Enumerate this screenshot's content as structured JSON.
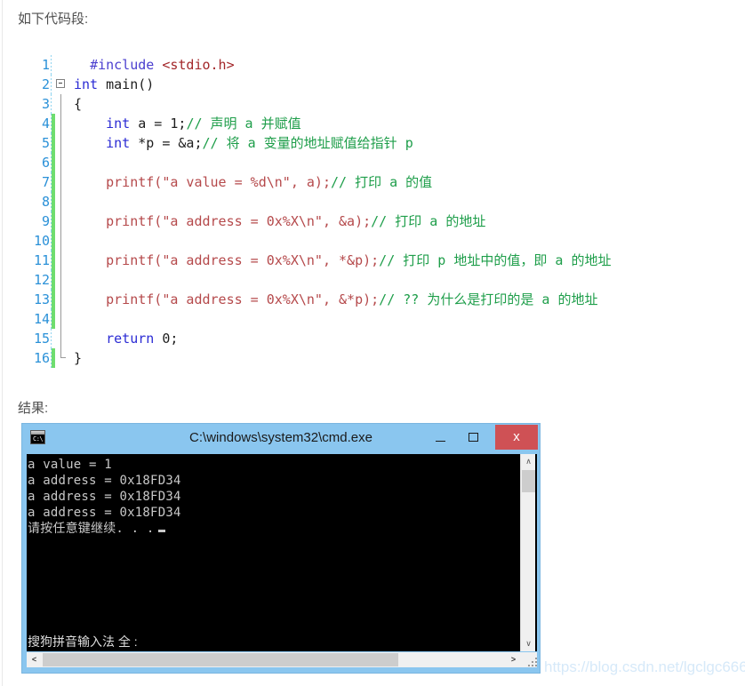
{
  "page": {
    "intro_label": "如下代码段:",
    "result_label": "结果:",
    "watermark": "https://blog.csdn.net/lgclgc666"
  },
  "code": {
    "language": "c",
    "lines": [
      {
        "num": "1",
        "fold": "none",
        "changed": false,
        "tokens": [
          {
            "t": "  ",
            "c": "plain"
          },
          {
            "t": "#include",
            "c": "pre"
          },
          {
            "t": " ",
            "c": "plain"
          },
          {
            "t": "<stdio.h>",
            "c": "hdr"
          }
        ]
      },
      {
        "num": "2",
        "fold": "open",
        "changed": false,
        "tokens": [
          {
            "t": "int",
            "c": "kw"
          },
          {
            "t": " main()",
            "c": "plain"
          }
        ]
      },
      {
        "num": "3",
        "fold": "line",
        "changed": false,
        "tokens": [
          {
            "t": "{",
            "c": "plain"
          }
        ]
      },
      {
        "num": "4",
        "fold": "line",
        "changed": true,
        "tokens": [
          {
            "t": "    ",
            "c": "plain"
          },
          {
            "t": "int",
            "c": "kw"
          },
          {
            "t": " a = 1;",
            "c": "plain"
          },
          {
            "t": "// 声明 a 并赋值",
            "c": "cmt"
          }
        ]
      },
      {
        "num": "5",
        "fold": "line",
        "changed": true,
        "tokens": [
          {
            "t": "    ",
            "c": "plain"
          },
          {
            "t": "int",
            "c": "kw"
          },
          {
            "t": " *p = &a;",
            "c": "plain"
          },
          {
            "t": "// 将 a 变量的地址赋值给指针 p",
            "c": "cmt"
          }
        ]
      },
      {
        "num": "6",
        "fold": "line",
        "changed": true,
        "tokens": [
          {
            "t": "",
            "c": "plain"
          }
        ]
      },
      {
        "num": "7",
        "fold": "line",
        "changed": true,
        "tokens": [
          {
            "t": "    ",
            "c": "plain"
          },
          {
            "t": "printf(\"a value = %d\\n\", a);",
            "c": "str"
          },
          {
            "t": "// 打印 a 的值",
            "c": "cmt"
          }
        ]
      },
      {
        "num": "8",
        "fold": "line",
        "changed": true,
        "tokens": [
          {
            "t": "",
            "c": "plain"
          }
        ]
      },
      {
        "num": "9",
        "fold": "line",
        "changed": true,
        "tokens": [
          {
            "t": "    ",
            "c": "plain"
          },
          {
            "t": "printf(\"a address = 0x%X\\n\", &a);",
            "c": "str"
          },
          {
            "t": "// 打印 a 的地址",
            "c": "cmt"
          }
        ]
      },
      {
        "num": "10",
        "fold": "line",
        "changed": true,
        "tokens": [
          {
            "t": "",
            "c": "plain"
          }
        ]
      },
      {
        "num": "11",
        "fold": "line",
        "changed": true,
        "tokens": [
          {
            "t": "    ",
            "c": "plain"
          },
          {
            "t": "printf(\"a address = 0x%X\\n\", *&p);",
            "c": "str"
          },
          {
            "t": "// 打印 p 地址中的值，即 a 的地址",
            "c": "cmt"
          }
        ]
      },
      {
        "num": "12",
        "fold": "line",
        "changed": true,
        "tokens": [
          {
            "t": "",
            "c": "plain"
          }
        ]
      },
      {
        "num": "13",
        "fold": "line",
        "changed": true,
        "tokens": [
          {
            "t": "    ",
            "c": "plain"
          },
          {
            "t": "printf(\"a address = 0x%X\\n\", &*p);",
            "c": "str"
          },
          {
            "t": "// ?? 为什么是打印的是 a 的地址",
            "c": "cmt"
          }
        ]
      },
      {
        "num": "14",
        "fold": "line",
        "changed": true,
        "tokens": [
          {
            "t": "",
            "c": "plain"
          }
        ]
      },
      {
        "num": "15",
        "fold": "line",
        "changed": false,
        "tokens": [
          {
            "t": "    ",
            "c": "plain"
          },
          {
            "t": "return",
            "c": "kw"
          },
          {
            "t": " 0;",
            "c": "plain"
          }
        ]
      },
      {
        "num": "16",
        "fold": "close",
        "changed": true,
        "tokens": [
          {
            "t": "}",
            "c": "plain"
          }
        ]
      }
    ]
  },
  "console_window": {
    "title": "C:\\windows\\system32\\cmd.exe",
    "icon": "cmd-icon",
    "prompt_glyph": "C:\\",
    "buttons": {
      "minimize": "–",
      "maximize": "▫",
      "close": "x"
    },
    "output_lines": [
      "a value = 1",
      "a address = 0x18FD34",
      "a address = 0x18FD34",
      "a address = 0x18FD34",
      "请按任意键继续. . ."
    ],
    "ime_status": "搜狗拼音输入法 全 :",
    "scroll": {
      "up_arrow": "∧",
      "down_arrow": "∨",
      "left_arrow": "<",
      "right_arrow": ">"
    }
  },
  "colors": {
    "title_bar": "#8ac6ef",
    "close_button": "#cf5155",
    "console_bg": "#000000",
    "console_fg": "#c8c8c8",
    "comment": "#1e9e4a",
    "keyword": "#2b2bd4",
    "string": "#b5494b",
    "line_number": "#2b91d8",
    "changed_marker": "#6fdd6f"
  }
}
